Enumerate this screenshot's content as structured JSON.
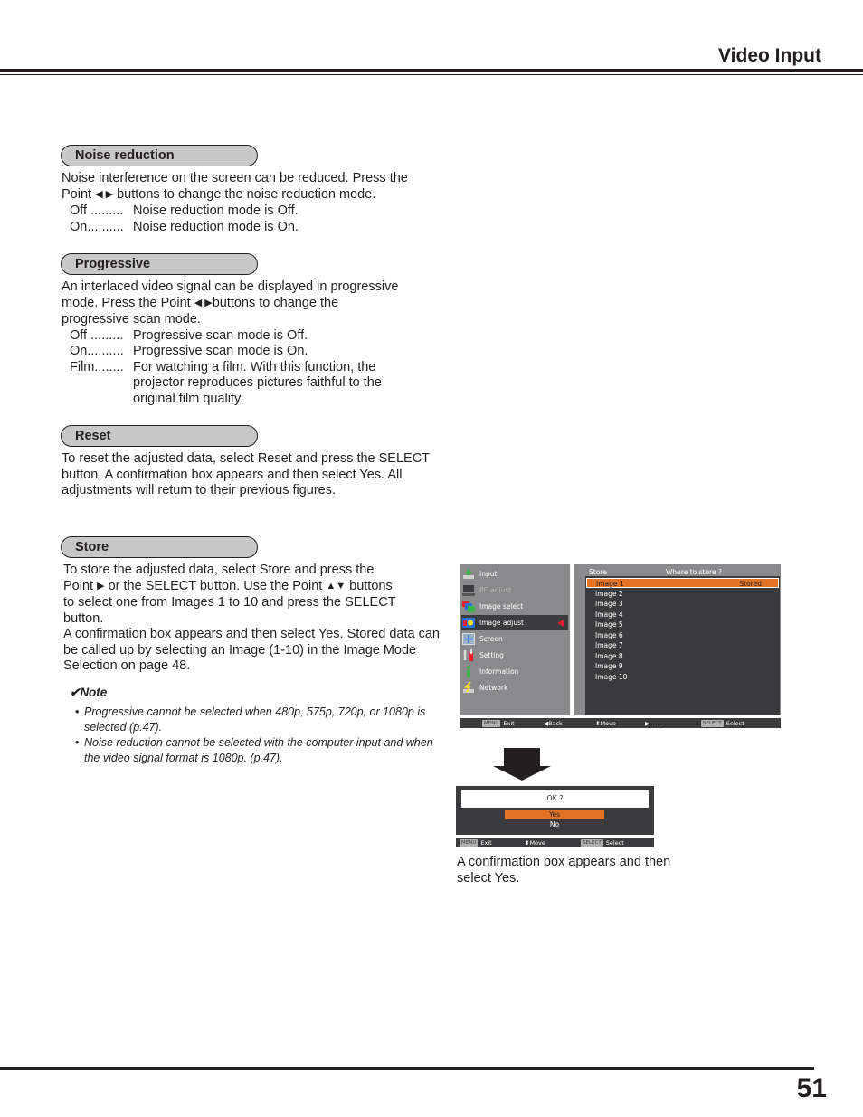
{
  "header": {
    "title": "Video Input"
  },
  "sections": {
    "noise": {
      "title": "Noise reduction",
      "intro_line1": "Noise interference on the screen can be reduced. Press the",
      "intro_line2_pre": "Point",
      "intro_line2_arrows": "◀ ▶",
      "intro_line2_post": " buttons to change the noise reduction mode.",
      "defs": [
        {
          "term": "Off .........",
          "desc": "Noise reduction mode is Off."
        },
        {
          "term": "On..........",
          "desc": "Noise reduction mode is On."
        }
      ]
    },
    "progressive": {
      "title": "Progressive",
      "intro_line1": "An interlaced video signal can be displayed in progressive",
      "intro_line2_pre": "mode. Press the Point",
      "intro_line2_arrows": "◀ ▶",
      "intro_line2_post": "buttons to change the",
      "intro_line3": "progressive scan mode.",
      "defs": [
        {
          "term": "Off .........",
          "desc": "Progressive scan mode is Off."
        },
        {
          "term": "On..........",
          "desc": "Progressive scan mode is On."
        },
        {
          "term": "Film........",
          "desc": "For watching a film. With this function, the projector reproduces pictures faithful to the original film quality."
        }
      ]
    },
    "reset": {
      "title": "Reset",
      "text": "To reset the adjusted data, select Reset and press the SELECT button. A confirmation box appears and then select Yes. All adjustments will return to their previous figures."
    },
    "store": {
      "title": "Store",
      "line1": "To store the adjusted data, select Store and press the",
      "line2_pre": "Point",
      "line2_arrow1": "▶",
      "line2_mid": " or the SELECT button. Use the Point ",
      "line2_arrow2": "▲▼",
      "line2_post": " buttons",
      "line3": "to select one from Images 1 to 10 and press the SELECT button.",
      "para2": "A confirmation box appears and then select Yes. Stored data can be called up by selecting an Image (1-10) in the Image Mode Selection on page 48."
    }
  },
  "note": {
    "check": "✔",
    "title": "Note",
    "items": [
      "Progressive cannot be selected when 480p, 575p, 720p, or 1080p is selected (p.47).",
      "Noise reduction cannot be selected with the computer input and when the video signal format is 1080p. (p.47)."
    ]
  },
  "osd_menu": {
    "menu_items": [
      {
        "label": "Input",
        "icon": "input-icon",
        "state": "normal"
      },
      {
        "label": "PC adjust",
        "icon": "pc-adjust-icon",
        "state": "disabled"
      },
      {
        "label": "Image select",
        "icon": "image-select-icon",
        "state": "normal"
      },
      {
        "label": "Image adjust",
        "icon": "image-adjust-icon",
        "state": "active"
      },
      {
        "label": "Screen",
        "icon": "screen-icon",
        "state": "normal"
      },
      {
        "label": "Setting",
        "icon": "setting-icon",
        "state": "normal"
      },
      {
        "label": "Information",
        "icon": "information-icon",
        "state": "normal"
      },
      {
        "label": "Network",
        "icon": "network-icon",
        "state": "normal"
      }
    ],
    "submenu_title": "Store",
    "submenu_prompt": "Where to store ?",
    "images": [
      {
        "name": "Image 1",
        "status": "Stored",
        "selected": true
      },
      {
        "name": "Image 2",
        "status": ""
      },
      {
        "name": "Image 3",
        "status": ""
      },
      {
        "name": "Image 4",
        "status": ""
      },
      {
        "name": "Image 5",
        "status": ""
      },
      {
        "name": "Image 6",
        "status": ""
      },
      {
        "name": "Image 7",
        "status": ""
      },
      {
        "name": "Image 8",
        "status": ""
      },
      {
        "name": "Image 9",
        "status": ""
      },
      {
        "name": "Image 10",
        "status": ""
      }
    ],
    "bottom_bar": {
      "exit_key": "MENU",
      "exit_label": "Exit",
      "back_label": "Back",
      "move_label": "Move",
      "right_label": "-----",
      "select_key": "SELECT",
      "select_label": "Select"
    },
    "colors": {
      "highlight": "#e37325",
      "panel": "#3b3b3d",
      "frame": "#8a8a8c",
      "pointer": "#e8202a"
    }
  },
  "confirm_dialog": {
    "question": "OK ?",
    "yes": "Yes",
    "no": "No",
    "bottom_bar": {
      "exit_key": "MENU",
      "exit_label": "Exit",
      "move_label": "Move",
      "select_key": "SELECT",
      "select_label": "Select"
    }
  },
  "caption": "A confirmation box appears and then select Yes.",
  "footer": {
    "page_number": "51"
  }
}
